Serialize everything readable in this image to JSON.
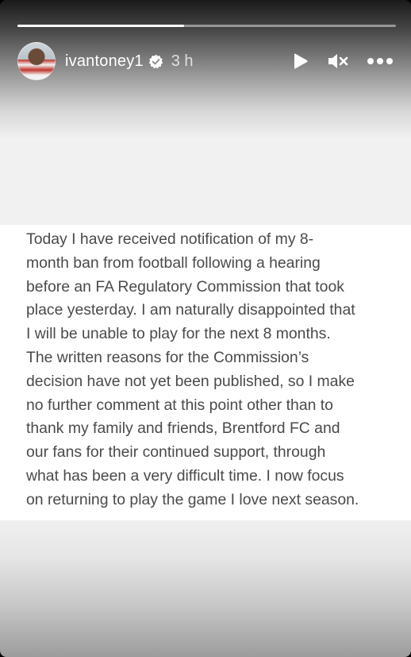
{
  "story": {
    "progress_percent": 44,
    "username": "ivantoney1",
    "verified": true,
    "time_ago": "3 h",
    "icons": {
      "avatar": "profile-photo",
      "verified": "verified-badge-icon",
      "play": "play-icon",
      "mute": "muted-speaker-icon",
      "more": "more-options-icon"
    }
  },
  "post": {
    "text": "Today I have received notification of my 8-\nmonth ban from football following a hearing\nbefore an FA Regulatory Commission that took\nplace yesterday. I am naturally disappointed that\nI will be unable to play for the next 8 months.\nThe written reasons for the Commission’s\ndecision have not yet been published, so I make\nno further comment at this point other than to\nthank my family and friends, Brentford FC and\nour fans for their continued support, through\nwhat has been a very difficult time. I now focus\non returning to play the game I love next season."
  }
}
